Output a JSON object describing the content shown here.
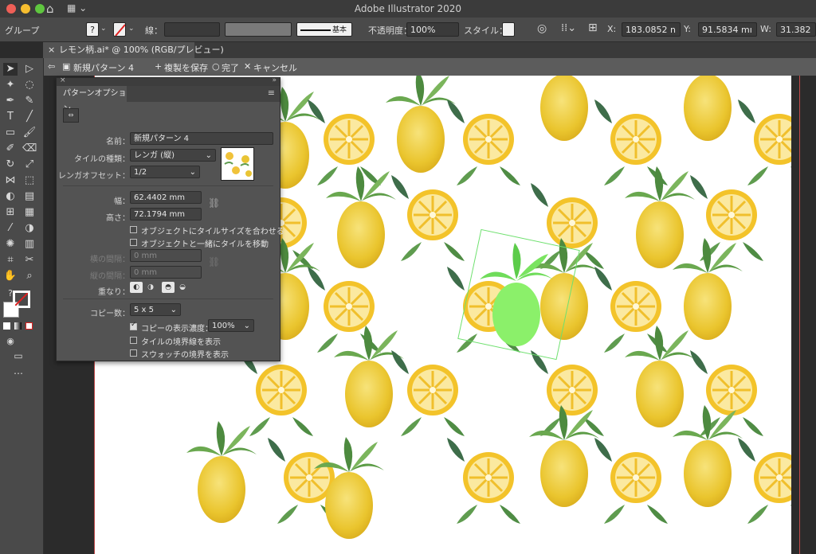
{
  "app": {
    "title": "Adobe Illustrator 2020"
  },
  "colors": {
    "accent_green": "#6ee06e",
    "traffic_red": "#ee5f57",
    "traffic_yellow": "#f6bd2f",
    "traffic_green": "#5fc63f"
  },
  "control_bar": {
    "group_label": "グループ",
    "question_label": "?",
    "stroke_label": "線：",
    "stroke_profile": "基本",
    "opacity_label": "不透明度：",
    "opacity_value": "100%",
    "style_label": "スタイル：",
    "x_label": "X:",
    "x_value": "183.0852 n",
    "y_label": "Y:",
    "y_value": "91.5834 mı",
    "w_label": "W:",
    "w_value": "31.382"
  },
  "document_tab": {
    "label": "レモン柄.ai* @ 100% (RGB/プレビュー)",
    "close": "×"
  },
  "isolation_bar": {
    "pattern_name": "新規パターン 4",
    "save_copy": "複製を保存",
    "done": "完了",
    "cancel": "キャンセル"
  },
  "pattern_panel": {
    "title": "パターンオプション",
    "name_label": "名前：",
    "name_value": "新規パターン 4",
    "tile_type_label": "タイルの種類：",
    "tile_type_value": "レンガ (縦)",
    "brick_offset_label": "レンガオフセット：",
    "brick_offset_value": "1/2",
    "width_label": "幅：",
    "width_value": "62.4402 mm",
    "height_label": "高さ：",
    "height_value": "72.1794 mm",
    "fit_tile_label": "オブジェクトにタイルサイズを合わせる",
    "move_tile_label": "オブジェクトと一緒にタイルを移動",
    "h_spacing_label": "横の間隔：",
    "h_spacing_value": "0 mm",
    "v_spacing_label": "縦の間隔：",
    "v_spacing_value": "0 mm",
    "overlap_label": "重なり：",
    "copies_label": "コピー数：",
    "copies_value": "5 x 5",
    "dim_copies_label": "コピーの表示濃度：",
    "dim_copies_value": "100%",
    "show_tile_edge_label": "タイルの境界線を表示",
    "show_swatch_bounds_label": "スウォッチの境界を表示",
    "dim_copies_checked": true
  }
}
